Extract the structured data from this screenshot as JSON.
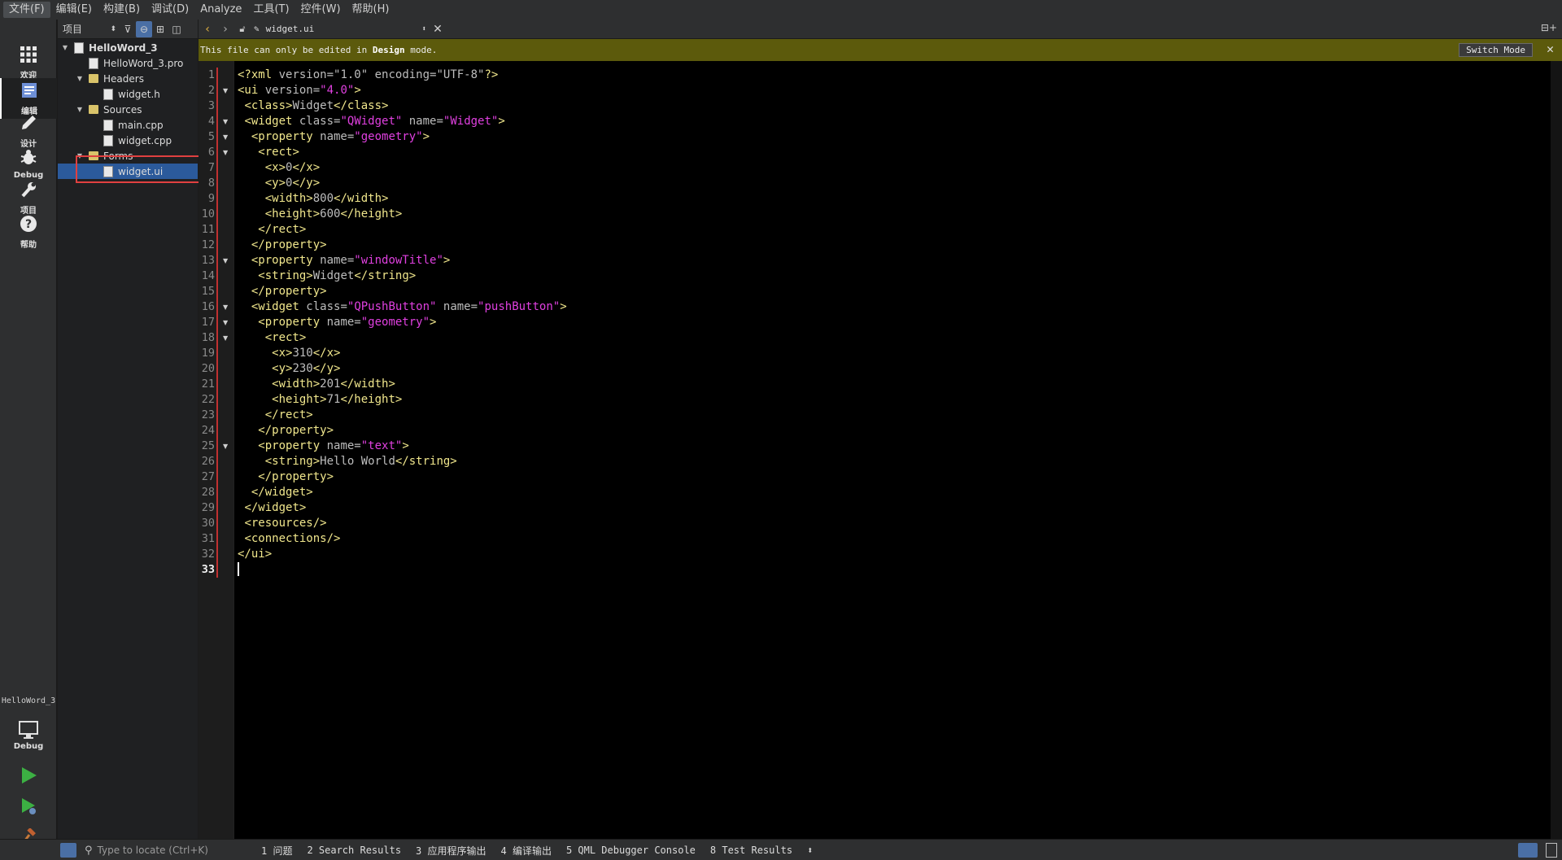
{
  "menu": [
    "文件(F)",
    "编辑(E)",
    "构建(B)",
    "调试(D)",
    "Analyze",
    "工具(T)",
    "控件(W)",
    "帮助(H)"
  ],
  "modes": [
    {
      "label": "欢迎",
      "icon": "grid-icon"
    },
    {
      "label": "编辑",
      "icon": "edit-icon"
    },
    {
      "label": "设计",
      "icon": "pen-icon"
    },
    {
      "label": "Debug",
      "icon": "bug-icon"
    },
    {
      "label": "项目",
      "icon": "wrench-icon"
    },
    {
      "label": "帮助",
      "icon": "help-icon"
    }
  ],
  "kit": {
    "project": "HelloWord_3",
    "build": "Debug"
  },
  "project_panel": {
    "selector": "项目"
  },
  "tree": [
    {
      "label": "HelloWord_3",
      "level": 0,
      "kind": "proj",
      "expanded": true
    },
    {
      "label": "HelloWord_3.pro",
      "level": 1,
      "kind": "doc"
    },
    {
      "label": "Headers",
      "level": 1,
      "kind": "folder",
      "expanded": true
    },
    {
      "label": "widget.h",
      "level": 2,
      "kind": "doc"
    },
    {
      "label": "Sources",
      "level": 1,
      "kind": "folder",
      "expanded": true
    },
    {
      "label": "main.cpp",
      "level": 2,
      "kind": "doc"
    },
    {
      "label": "widget.cpp",
      "level": 2,
      "kind": "doc"
    },
    {
      "label": "Forms",
      "level": 1,
      "kind": "folder",
      "expanded": true
    },
    {
      "label": "widget.ui",
      "level": 2,
      "kind": "doc",
      "selected": true
    }
  ],
  "editor_tab": {
    "filename": "widget.ui"
  },
  "infobar": {
    "pre": "This file can only be edited in ",
    "bold": "Design",
    "post": " mode.",
    "button": "Switch Mode"
  },
  "code": [
    [
      [
        "t",
        "<?xml"
      ],
      [
        "a",
        " version="
      ],
      [
        "s",
        "\"1.0\""
      ],
      [
        "a",
        " encoding="
      ],
      [
        "s",
        "\"UTF-8\""
      ],
      [
        "t",
        "?>"
      ]
    ],
    [
      [
        "t",
        "<ui"
      ],
      [
        "a",
        " version="
      ],
      [
        "v",
        "\"4.0\""
      ],
      [
        "t",
        ">"
      ]
    ],
    [
      [
        "p",
        " "
      ],
      [
        "t",
        "<class>"
      ],
      [
        "x",
        "Widget"
      ],
      [
        "t",
        "</class>"
      ]
    ],
    [
      [
        "p",
        " "
      ],
      [
        "t",
        "<widget"
      ],
      [
        "a",
        " class="
      ],
      [
        "v",
        "\"QWidget\""
      ],
      [
        "a",
        " name="
      ],
      [
        "v",
        "\"Widget\""
      ],
      [
        "t",
        ">"
      ]
    ],
    [
      [
        "p",
        "  "
      ],
      [
        "t",
        "<property"
      ],
      [
        "a",
        " name="
      ],
      [
        "v",
        "\"geometry\""
      ],
      [
        "t",
        ">"
      ]
    ],
    [
      [
        "p",
        "   "
      ],
      [
        "t",
        "<rect>"
      ]
    ],
    [
      [
        "p",
        "    "
      ],
      [
        "t",
        "<x>"
      ],
      [
        "x",
        "0"
      ],
      [
        "t",
        "</x>"
      ]
    ],
    [
      [
        "p",
        "    "
      ],
      [
        "t",
        "<y>"
      ],
      [
        "x",
        "0"
      ],
      [
        "t",
        "</y>"
      ]
    ],
    [
      [
        "p",
        "    "
      ],
      [
        "t",
        "<width>"
      ],
      [
        "x",
        "800"
      ],
      [
        "t",
        "</width>"
      ]
    ],
    [
      [
        "p",
        "    "
      ],
      [
        "t",
        "<height>"
      ],
      [
        "x",
        "600"
      ],
      [
        "t",
        "</height>"
      ]
    ],
    [
      [
        "p",
        "   "
      ],
      [
        "t",
        "</rect>"
      ]
    ],
    [
      [
        "p",
        "  "
      ],
      [
        "t",
        "</property>"
      ]
    ],
    [
      [
        "p",
        "  "
      ],
      [
        "t",
        "<property"
      ],
      [
        "a",
        " name="
      ],
      [
        "v",
        "\"windowTitle\""
      ],
      [
        "t",
        ">"
      ]
    ],
    [
      [
        "p",
        "   "
      ],
      [
        "t",
        "<string>"
      ],
      [
        "x",
        "Widget"
      ],
      [
        "t",
        "</string>"
      ]
    ],
    [
      [
        "p",
        "  "
      ],
      [
        "t",
        "</property>"
      ]
    ],
    [
      [
        "p",
        "  "
      ],
      [
        "t",
        "<widget"
      ],
      [
        "a",
        " class="
      ],
      [
        "v",
        "\"QPushButton\""
      ],
      [
        "a",
        " name="
      ],
      [
        "v",
        "\"pushButton\""
      ],
      [
        "t",
        ">"
      ]
    ],
    [
      [
        "p",
        "   "
      ],
      [
        "t",
        "<property"
      ],
      [
        "a",
        " name="
      ],
      [
        "v",
        "\"geometry\""
      ],
      [
        "t",
        ">"
      ]
    ],
    [
      [
        "p",
        "    "
      ],
      [
        "t",
        "<rect>"
      ]
    ],
    [
      [
        "p",
        "     "
      ],
      [
        "t",
        "<x>"
      ],
      [
        "x",
        "310"
      ],
      [
        "t",
        "</x>"
      ]
    ],
    [
      [
        "p",
        "     "
      ],
      [
        "t",
        "<y>"
      ],
      [
        "x",
        "230"
      ],
      [
        "t",
        "</y>"
      ]
    ],
    [
      [
        "p",
        "     "
      ],
      [
        "t",
        "<width>"
      ],
      [
        "x",
        "201"
      ],
      [
        "t",
        "</width>"
      ]
    ],
    [
      [
        "p",
        "     "
      ],
      [
        "t",
        "<height>"
      ],
      [
        "x",
        "71"
      ],
      [
        "t",
        "</height>"
      ]
    ],
    [
      [
        "p",
        "    "
      ],
      [
        "t",
        "</rect>"
      ]
    ],
    [
      [
        "p",
        "   "
      ],
      [
        "t",
        "</property>"
      ]
    ],
    [
      [
        "p",
        "   "
      ],
      [
        "t",
        "<property"
      ],
      [
        "a",
        " name="
      ],
      [
        "v",
        "\"text\""
      ],
      [
        "t",
        ">"
      ]
    ],
    [
      [
        "p",
        "    "
      ],
      [
        "t",
        "<string>"
      ],
      [
        "x",
        "Hello World"
      ],
      [
        "t",
        "</string>"
      ]
    ],
    [
      [
        "p",
        "   "
      ],
      [
        "t",
        "</property>"
      ]
    ],
    [
      [
        "p",
        "  "
      ],
      [
        "t",
        "</widget>"
      ]
    ],
    [
      [
        "p",
        " "
      ],
      [
        "t",
        "</widget>"
      ]
    ],
    [
      [
        "p",
        " "
      ],
      [
        "t",
        "<resources/>"
      ]
    ],
    [
      [
        "p",
        " "
      ],
      [
        "t",
        "<connections/>"
      ]
    ],
    [
      [
        "t",
        "</ui>"
      ]
    ],
    []
  ],
  "fold_lines": [
    2,
    4,
    5,
    6,
    13,
    16,
    17,
    18,
    25
  ],
  "current_line": 33,
  "locator": {
    "placeholder": "Type to locate (Ctrl+K)"
  },
  "output_tabs": [
    "1 问题",
    "2 Search Results",
    "3 应用程序输出",
    "4 编译输出",
    "5 QML Debugger Console",
    "8 Test Results"
  ],
  "colors": {
    "tag": "#f0e68c",
    "value": "#e040e0",
    "text": "#bdbdbd",
    "infobar": "#5c5a0c",
    "selection": "#2b5a9b"
  }
}
